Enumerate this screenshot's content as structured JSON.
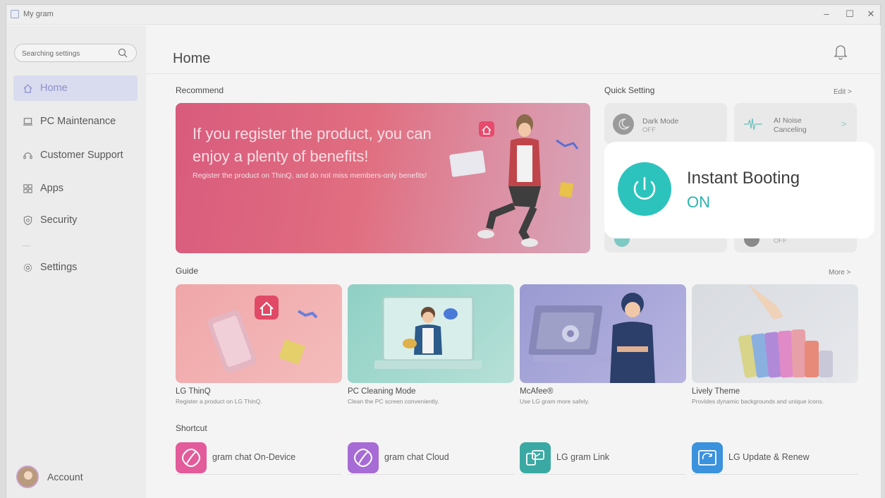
{
  "window": {
    "title": "My gram",
    "controls": [
      "–",
      "☐",
      "✕"
    ]
  },
  "search": {
    "placeholder": "Searching settings"
  },
  "sidebar": {
    "items": [
      {
        "label": "Home",
        "icon": "home-icon"
      },
      {
        "label": "PC Maintenance",
        "icon": "laptop-icon"
      },
      {
        "label": "Customer Support",
        "icon": "headset-icon"
      },
      {
        "label": "Apps",
        "icon": "apps-grid-icon"
      },
      {
        "label": "Security",
        "icon": "shield-icon"
      },
      {
        "label": "Settings",
        "icon": "gear-icon"
      }
    ],
    "account_label": "Account"
  },
  "header": {
    "title": "Home"
  },
  "recommend": {
    "label": "Recommend",
    "banner_heading": "If you register the product, you can enjoy a plenty of benefits!",
    "banner_sub": "Register the product on ThinQ, and do not miss members-only benefits!"
  },
  "quick_setting": {
    "label": "Quick Setting",
    "edit": "Edit >",
    "dark_mode": {
      "title": "Dark Mode",
      "status": "OFF"
    },
    "ai_noise": {
      "title": "AI Noise Canceling",
      "arrow": ">"
    },
    "hidden_status": "OFF",
    "popup": {
      "title": "Instant Booting",
      "status": "ON"
    }
  },
  "guide": {
    "label": "Guide",
    "more": "More >",
    "cards": [
      {
        "title": "LG ThinQ",
        "desc": "Register a product on LG ThinQ."
      },
      {
        "title": "PC Cleaning Mode",
        "desc": "Clean the PC screen conveniently."
      },
      {
        "title": "McAfee®",
        "desc": "Use LG gram more safely."
      },
      {
        "title": "Lively Theme",
        "desc": "Provides dynamic backgrounds and unique icons."
      }
    ]
  },
  "shortcut": {
    "label": "Shortcut",
    "items": [
      {
        "label": "gram chat On-Device",
        "color": "#e35b9a"
      },
      {
        "label": "gram chat Cloud",
        "color": "#a76bd6"
      },
      {
        "label": "LG gram Link",
        "color": "#3ba9a3"
      },
      {
        "label": "LG Update & Renew",
        "color": "#3b92dd"
      }
    ]
  },
  "colors": {
    "accent": "#2dc3bd",
    "nav_active_bg": "#d9dbef",
    "nav_active_text": "#8c8fc8"
  }
}
